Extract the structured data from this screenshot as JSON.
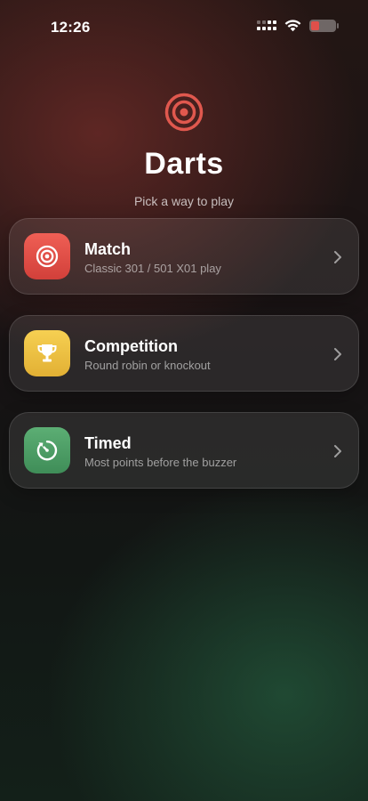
{
  "status_bar": {
    "time": "12:26",
    "battery_color": "#e0504a"
  },
  "hero": {
    "icon": "target-icon",
    "title": "Darts",
    "subtitle": "Pick a way to play",
    "accent": "#e0584e"
  },
  "options": [
    {
      "title": "Match",
      "subtitle": "Classic 301 / 501 X01 play",
      "icon": "target-icon",
      "color_top": "#ef5f55",
      "color_bottom": "#d2403a"
    },
    {
      "title": "Competition",
      "subtitle": "Round robin or knockout",
      "icon": "trophy-icon",
      "color_top": "#f6d052",
      "color_bottom": "#e2b034"
    },
    {
      "title": "Timed",
      "subtitle": "Most points before the buzzer",
      "icon": "stopwatch-icon",
      "color_top": "#5cae74",
      "color_bottom": "#3f8d58"
    }
  ]
}
